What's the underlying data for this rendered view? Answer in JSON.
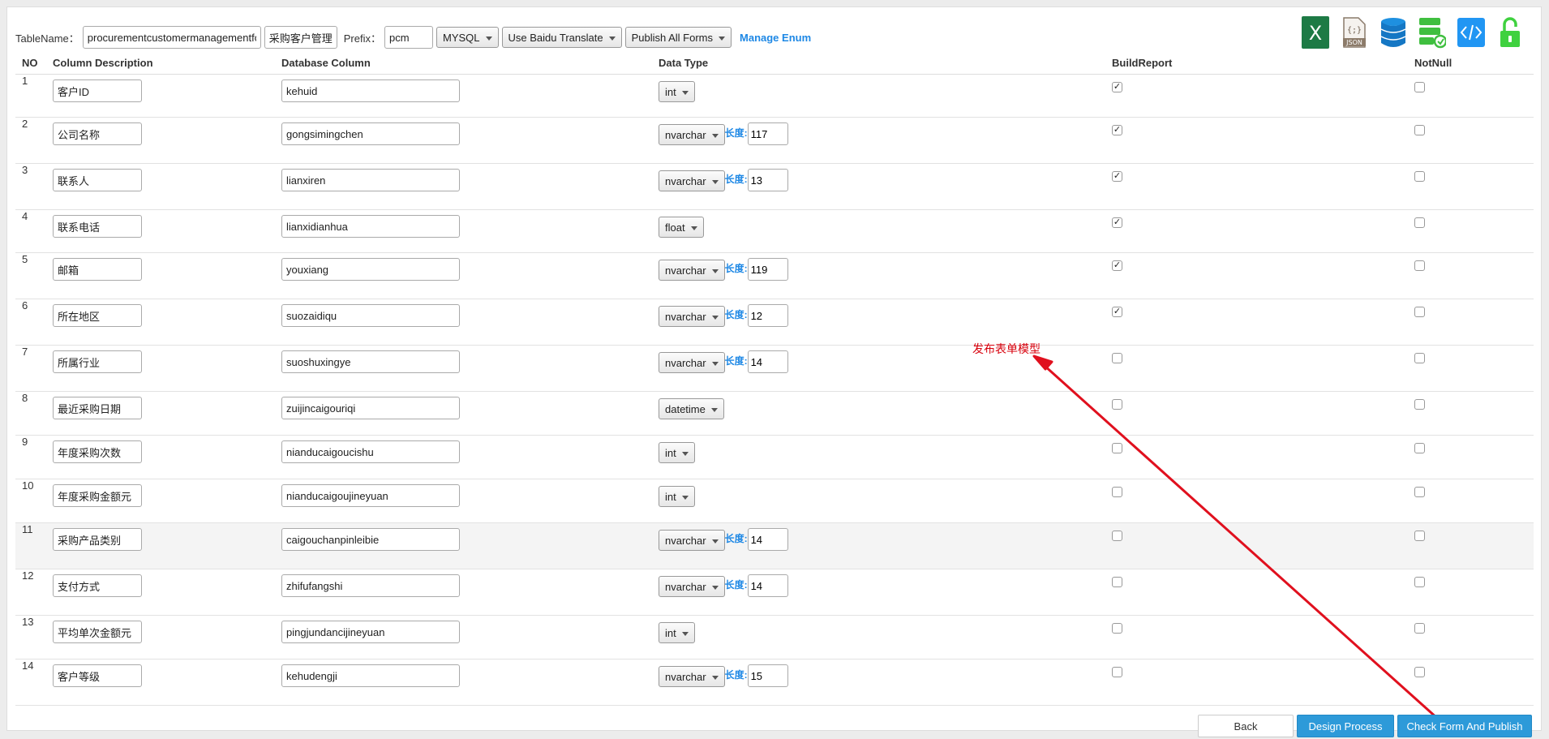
{
  "toolbar": {
    "table_name_label": "TableName：",
    "table_name_value": "procurementcustomermanagementform",
    "table_cn_value": "采购客户管理表",
    "prefix_label": "Prefix：",
    "prefix_value": "pcm",
    "db_select": "MYSQL",
    "translate_select": "Use Baidu Translate",
    "publish_select": "Publish All Forms",
    "manage_enum": "Manage Enum"
  },
  "icons": [
    "excel-icon",
    "json-icon",
    "database-icon",
    "server-sync-icon",
    "code-icon",
    "unlock-icon"
  ],
  "columns": {
    "no": "NO",
    "desc": "Column Description",
    "db": "Database Column",
    "type": "Data Type",
    "report": "BuildReport",
    "notnull": "NotNull"
  },
  "length_label": "长度:",
  "rows": [
    {
      "no": "1",
      "desc": "客户ID",
      "db": "kehuid",
      "type": "int",
      "length": "",
      "report": "✓",
      "notnull": ""
    },
    {
      "no": "2",
      "desc": "公司名称",
      "db": "gongsimingchen",
      "type": "nvarchar",
      "length": "117",
      "report": "✓",
      "notnull": ""
    },
    {
      "no": "3",
      "desc": "联系人",
      "db": "lianxiren",
      "type": "nvarchar",
      "length": "13",
      "report": "✓",
      "notnull": ""
    },
    {
      "no": "4",
      "desc": "联系电话",
      "db": "lianxidianhua",
      "type": "float",
      "length": "",
      "report": "✓",
      "notnull": ""
    },
    {
      "no": "5",
      "desc": "邮箱",
      "db": "youxiang",
      "type": "nvarchar",
      "length": "119",
      "report": "✓",
      "notnull": ""
    },
    {
      "no": "6",
      "desc": "所在地区",
      "db": "suozaidiqu",
      "type": "nvarchar",
      "length": "12",
      "report": "✓",
      "notnull": ""
    },
    {
      "no": "7",
      "desc": "所属行业",
      "db": "suoshuxingye",
      "type": "nvarchar",
      "length": "14",
      "report": "",
      "notnull": ""
    },
    {
      "no": "8",
      "desc": "最近采购日期",
      "db": "zuijincaigouriqi",
      "type": "datetime",
      "length": "",
      "report": "",
      "notnull": ""
    },
    {
      "no": "9",
      "desc": "年度采购次数",
      "db": "nianducaigoucishu",
      "type": "int",
      "length": "",
      "report": "",
      "notnull": ""
    },
    {
      "no": "10",
      "desc": "年度采购金额元",
      "db": "nianducaigoujineyuan",
      "type": "int",
      "length": "",
      "report": "",
      "notnull": ""
    },
    {
      "no": "11",
      "desc": "采购产品类别",
      "db": "caigouchanpinleibie",
      "type": "nvarchar",
      "length": "14",
      "report": "",
      "notnull": ""
    },
    {
      "no": "12",
      "desc": "支付方式",
      "db": "zhifufangshi",
      "type": "nvarchar",
      "length": "14",
      "report": "",
      "notnull": ""
    },
    {
      "no": "13",
      "desc": "平均单次金额元",
      "db": "pingjundancijineyuan",
      "type": "int",
      "length": "",
      "report": "",
      "notnull": ""
    },
    {
      "no": "14",
      "desc": "客户等级",
      "db": "kehudengji",
      "type": "nvarchar",
      "length": "15",
      "report": "",
      "notnull": ""
    }
  ],
  "annotation": "发布表单模型",
  "buttons": {
    "back": "Back",
    "design_process": "Design Process",
    "check_publish": "Check Form And Publish"
  },
  "colors": {
    "accent": "#2d9ad9",
    "link": "#1e88e5",
    "annotation": "#d8000c"
  }
}
